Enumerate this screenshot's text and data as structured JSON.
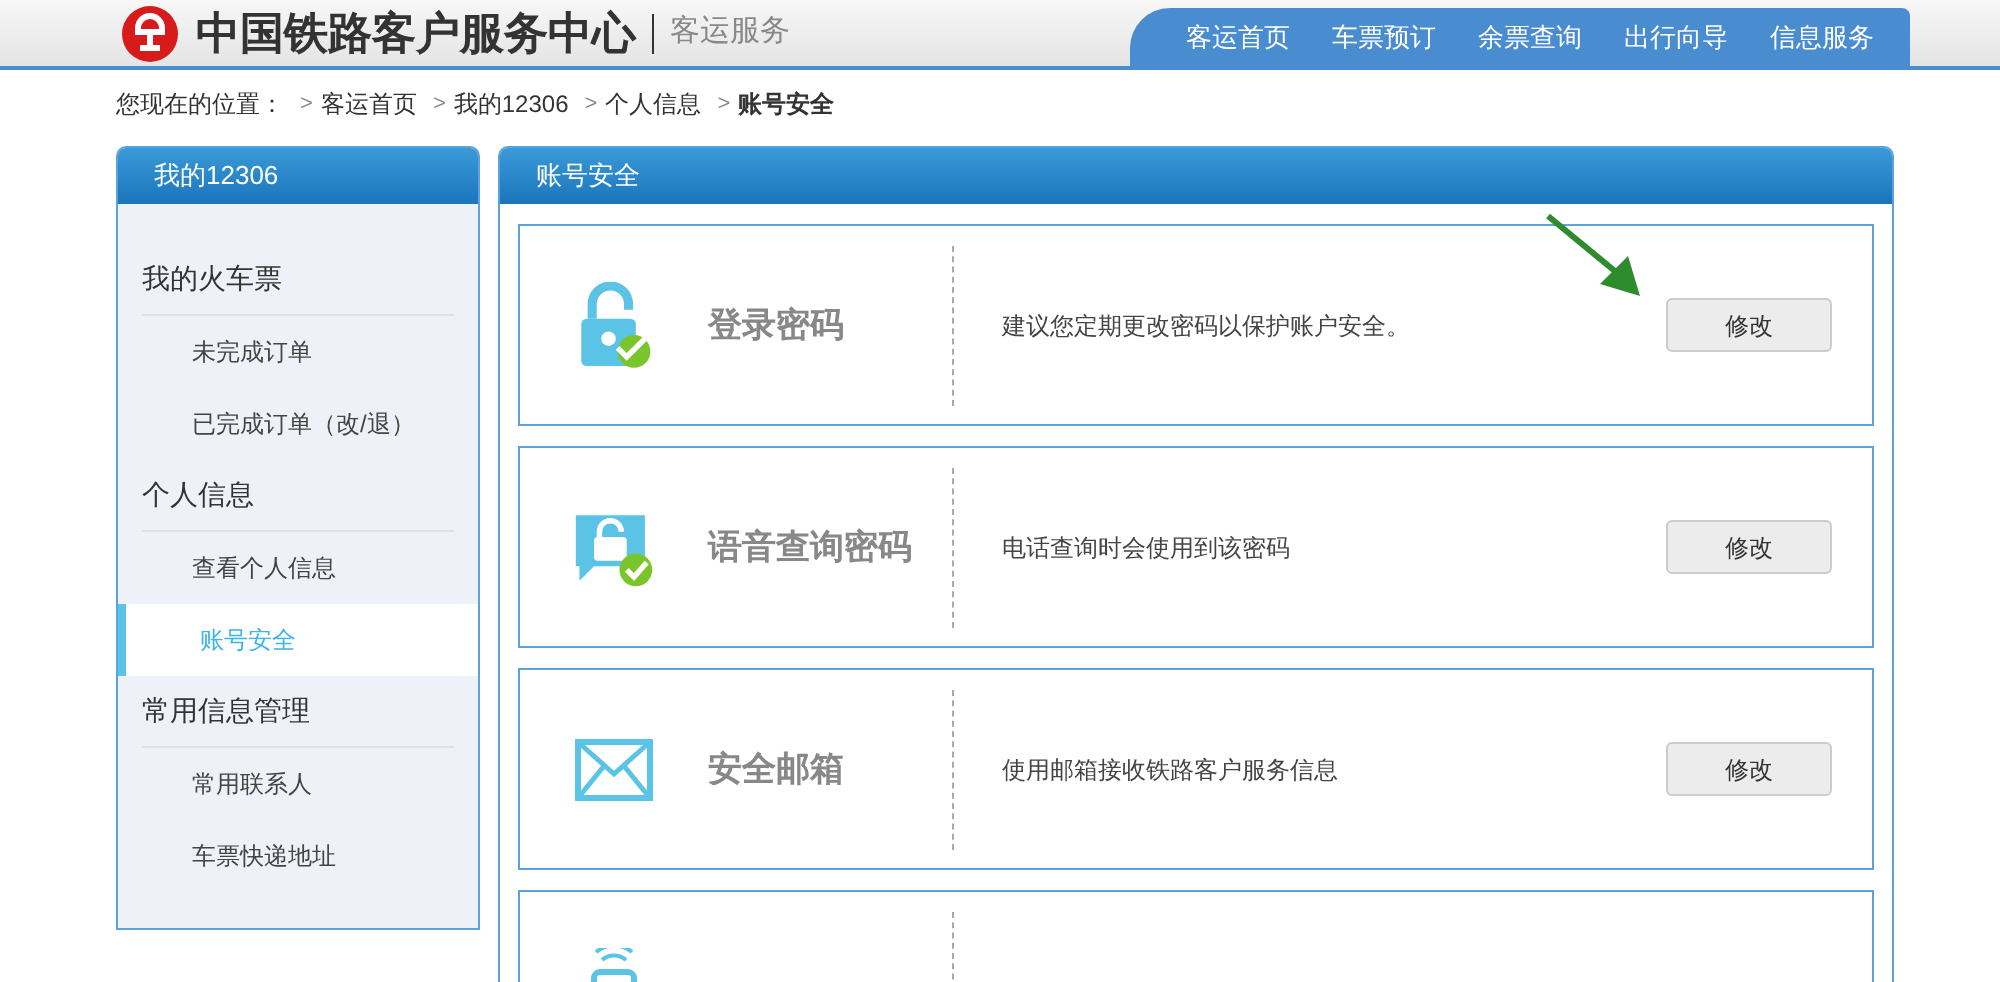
{
  "header": {
    "title": "中国铁路客户服务中心",
    "subtitle": "客运服务",
    "nav": [
      "客运首页",
      "车票预订",
      "余票查询",
      "出行向导",
      "信息服务"
    ]
  },
  "breadcrumb": {
    "label": "您现在的位置：",
    "separator": ">",
    "links": [
      "客运首页",
      "我的12306",
      "个人信息"
    ],
    "current": "账号安全"
  },
  "sidebar": {
    "title": "我的12306",
    "groups": [
      {
        "label": "我的火车票",
        "items": [
          {
            "label": "未完成订单",
            "selected": false
          },
          {
            "label": "已完成订单（改/退）",
            "selected": false
          }
        ]
      },
      {
        "label": "个人信息",
        "items": [
          {
            "label": "查看个人信息",
            "selected": false
          },
          {
            "label": "账号安全",
            "selected": true
          }
        ]
      },
      {
        "label": "常用信息管理",
        "items": [
          {
            "label": "常用联系人",
            "selected": false
          },
          {
            "label": "车票快递地址",
            "selected": false
          }
        ]
      }
    ]
  },
  "panel": {
    "title": "账号安全",
    "cards": [
      {
        "kind": "lock",
        "title": "登录密码",
        "description": "建议您定期更改密码以保护账户安全。",
        "button": "修改"
      },
      {
        "kind": "voice",
        "title": "语音查询密码",
        "description": "电话查询时会使用到该密码",
        "button": "修改"
      },
      {
        "kind": "mail",
        "title": "安全邮箱",
        "description": "使用邮箱接收铁路客户服务信息",
        "button": "修改"
      },
      {
        "kind": "phone"
      }
    ]
  }
}
